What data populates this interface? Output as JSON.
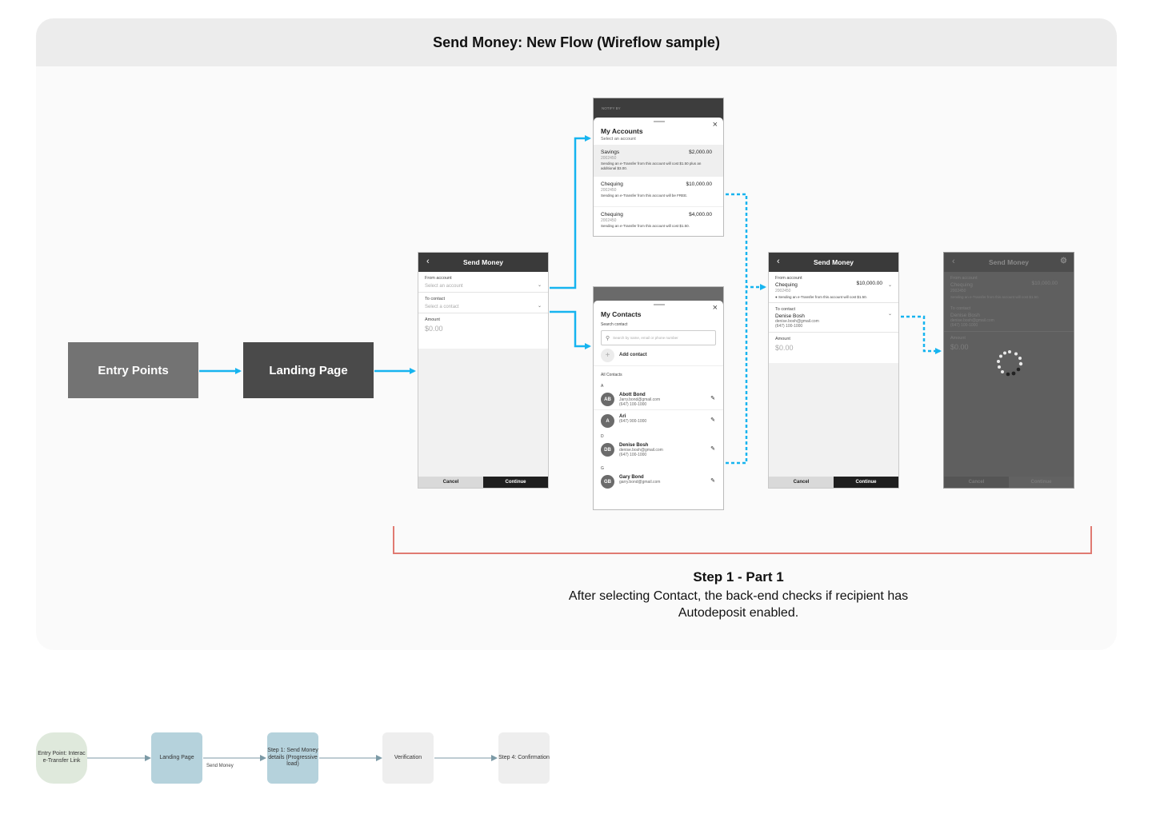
{
  "title": "Send Money: New Flow  (Wireflow sample)",
  "flow_boxes": {
    "entry_points": "Entry Points",
    "landing_page": "Landing Page"
  },
  "send_money_screen": {
    "title": "Send Money",
    "from_label": "From account",
    "from_placeholder": "Select an account",
    "to_label": "To contact",
    "to_placeholder": "Select a contact",
    "amount_label": "Amount",
    "amount_value": "$0.00",
    "cancel": "Cancel",
    "continue": "Continue"
  },
  "accounts_sheet": {
    "notify_label": "NOTIFY BY",
    "title": "My Accounts",
    "subtitle": "Select an account",
    "accounts": [
      {
        "name": "Savings",
        "balance": "$2,000.00",
        "number": "2002450",
        "note": "Sending an e-Transfer from this account will cost $1.50 plus an additional $3.00."
      },
      {
        "name": "Chequing",
        "balance": "$10,000.00",
        "number": "2002450",
        "note": "Sending an e-Transfer from this account will be FREE."
      },
      {
        "name": "Chequing",
        "balance": "$4,000.00",
        "number": "2002450",
        "note": "Sending an e-Transfer from this account will cost $1.50."
      }
    ]
  },
  "contacts_sheet": {
    "title": "My Contacts",
    "search_label": "Search contact",
    "search_placeholder": "Search by name, email or phone number",
    "add_contact": "Add contact",
    "all_contacts": "All Contacts",
    "groups": [
      {
        "letter": "A",
        "contacts": [
          {
            "initials": "AB",
            "name": "Abott Bond",
            "email": "Jarry.bond@gmail.com",
            "phone": "(647) 100-1000"
          },
          {
            "initials": "A",
            "name": "Ari",
            "email": "",
            "phone": "(647) 900-1000"
          }
        ]
      },
      {
        "letter": "D",
        "contacts": [
          {
            "initials": "DB",
            "name": "Denise Bosh",
            "email": "denise.bosh@gmail.com",
            "phone": "(647) 100-1000"
          }
        ]
      },
      {
        "letter": "G",
        "contacts": [
          {
            "initials": "GB",
            "name": "Gary Bond",
            "email": "garry.bond@gmail.com",
            "phone": ""
          }
        ]
      }
    ]
  },
  "filled_screen": {
    "title": "Send Money",
    "from_label": "From account",
    "account_name": "Chequing",
    "account_balance": "$10,000.00",
    "account_number": "2002450",
    "fee_note": "Sending an e-Transfer from this account will cost $1.50.",
    "to_label": "To contact",
    "contact_name": "Denise Bosh",
    "contact_email": "denise.bosh@gmail.com",
    "contact_phone": "(647) 100-1000",
    "amount_label": "Amount",
    "amount_value": "$0.00",
    "cancel": "Cancel",
    "continue": "Continue"
  },
  "loading_screen": {
    "title": "Send Money",
    "from_label": "From account",
    "account_name": "Chequing",
    "account_balance": "$10,000.00",
    "account_number": "2002450",
    "fee_note": "Sending an e-Transfer from this account will cost $1.50.",
    "to_label": "To contact",
    "contact_name": "Denise Bosh",
    "contact_email": "denise.bosh@gmail.com",
    "contact_phone": "(647) 100-1000",
    "amount_label": "Amount",
    "amount_value": "$0.00",
    "cancel": "Cancel",
    "continue": "Continue"
  },
  "step": {
    "heading": "Step 1 - Part 1",
    "description": "After selecting Contact, the back-end checks if recipient has Autodeposit enabled."
  },
  "mini_flow": {
    "entry": "Entry Point: Interac e-Transfer Link",
    "landing": "Landing Page",
    "arrow_label": "Send Money",
    "step1": "Step 1: Send Money details (Progressive load)",
    "verification": "Verification",
    "step4": "Step 4: Confirmation"
  },
  "colors": {
    "arrow": "#16b4ef",
    "bracket": "#e07a72",
    "mini_green": "#dfe9dc",
    "mini_blue": "#b5d2dc",
    "mini_grey": "#eeeeee"
  }
}
